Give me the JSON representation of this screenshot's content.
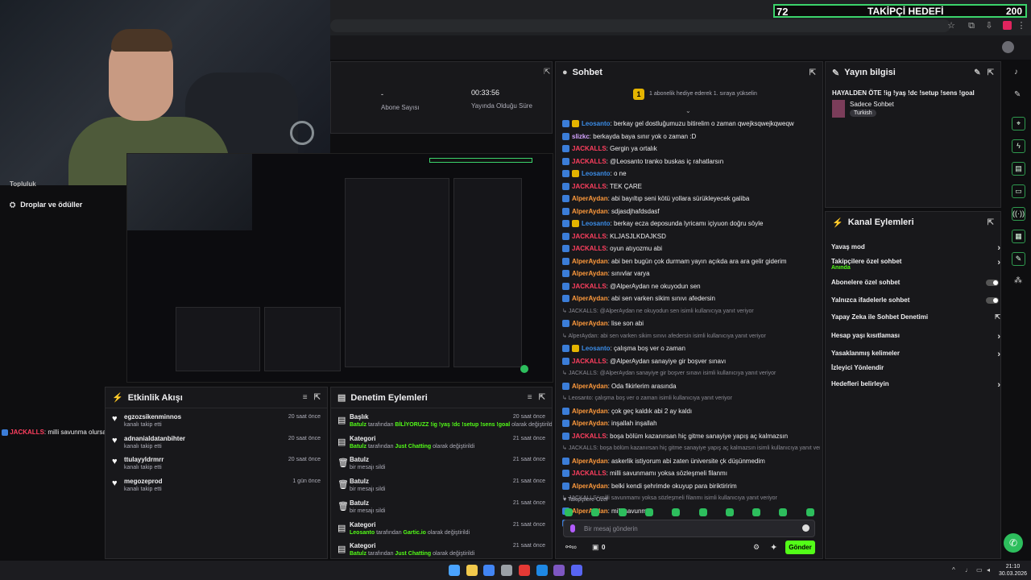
{
  "goal": {
    "current": "72",
    "title": "TAKİPÇİ HEDEFİ",
    "target": "200"
  },
  "stats": [
    {
      "value": "-",
      "label": "Abone Sayısı"
    },
    {
      "value": "00:33:56",
      "label": "Yayında Olduğu Süre"
    }
  ],
  "left_nav": {
    "item_rewards": "Droplar ve ödüller",
    "item_partial": "Topluluk"
  },
  "overlay_chat": {
    "user": "JACKALLS",
    "text": ": milli savunma olursa iyide diğerleri boş"
  },
  "chat": {
    "title": "Sohbet",
    "banner": "1 abonelik hediye ederek 1. sıraya yükselin",
    "messages": [
      {
        "user": "Leosanto",
        "color": "#3b8de8",
        "crown": true,
        "text": ": berkay gel dostluğumuzu bitirelim o zaman qwejksqwejkqweqw"
      },
      {
        "user": "slizkc",
        "color": "#d4a3ff",
        "text": ": berkayda baya sınır yok o zaman :D"
      },
      {
        "user": "JACKALLS",
        "color": "#ff3f5f",
        "text": ": Gergin ya ortalık"
      },
      {
        "user": "JACKALLS",
        "color": "#ff3f5f",
        "text": ": @Leosanto tranko buskas iç rahatlarsın"
      },
      {
        "user": "Leosanto",
        "color": "#3b8de8",
        "crown": true,
        "text": ": o ne"
      },
      {
        "user": "JACKALLS",
        "color": "#ff3f5f",
        "text": ": TEK ÇARE"
      },
      {
        "user": "AlperAydan",
        "color": "#ff9a3c",
        "text": ": abi bayıltıp seni kötü yollara sürükleyecek galiba"
      },
      {
        "user": "AlperAydan",
        "color": "#ff9a3c",
        "text": ": sdjasdjhafdsdasf"
      },
      {
        "user": "Leosanto",
        "color": "#3b8de8",
        "crown": true,
        "text": ": berkay ecza deposunda lyricamı içiyuon doğru söyle"
      },
      {
        "user": "JACKALLS",
        "color": "#ff3f5f",
        "text": ": KLJASJLKDAJKSD"
      },
      {
        "user": "JACKALLS",
        "color": "#ff3f5f",
        "text": ": oyun atıyozmu abi"
      },
      {
        "user": "AlperAydan",
        "color": "#ff9a3c",
        "text": ": abi ben bugün çok durmam yayın açıkda ara ara gelir giderim"
      },
      {
        "user": "AlperAydan",
        "color": "#ff9a3c",
        "text": ": sınıvlar varya"
      },
      {
        "user": "JACKALLS",
        "color": "#ff3f5f",
        "text": ": @AlperAydan ne okuyodun sen"
      },
      {
        "user": "AlperAydan",
        "color": "#ff9a3c",
        "text": ": abi sen varken sikim sınıvı afedersin"
      },
      {
        "reply": "JACKALLS: @AlperAydan ne okuyodun sen isimli kullanıcıya yanıt veriyor"
      },
      {
        "user": "AlperAydan",
        "color": "#ff9a3c",
        "text": ": lise son abi"
      },
      {
        "reply": "AlperAydan: abi sen varken sikim sınıvı afedersin isimli kullanıcıya yanıt veriyor"
      },
      {
        "user": "Leosanto",
        "color": "#3b8de8",
        "crown": true,
        "text": ": çalışma boş ver o zaman"
      },
      {
        "user": "JACKALLS",
        "color": "#ff3f5f",
        "text": ": @AlperAydan sanayiye gir boşver sınavı"
      },
      {
        "reply": "JACKALLS: @AlperAydan sanayiye gir boşver sınavı isimli kullanıcıya yanıt veriyor"
      },
      {
        "user": "AlperAydan",
        "color": "#ff9a3c",
        "text": ": Oda fikirlerim arasında"
      },
      {
        "reply": "Leosanto: çalışma boş ver o zaman isimli kullanıcıya yanıt veriyor"
      },
      {
        "user": "AlperAydan",
        "color": "#ff9a3c",
        "text": ": çok geç kaldık abi 2 ay kaldı"
      },
      {
        "user": "AlperAydan",
        "color": "#ff9a3c",
        "text": ": inşallah inşallah"
      },
      {
        "user": "JACKALLS",
        "color": "#ff3f5f",
        "text": ": boşa bölüm kazanırsan hiç gitme sanayiye yapış aç kalmazsın"
      },
      {
        "reply": "JACKALLS: boşa bölüm kazanırsan hiç gitme sanayiye yapış aç kalmazsın isimli kullanıcıya yanıt veriyor"
      },
      {
        "user": "AlperAydan",
        "color": "#ff9a3c",
        "text": ": askerlik istiyorum abi zaten üniversite çk düşünmedim"
      },
      {
        "user": "JACKALLS",
        "color": "#ff3f5f",
        "text": ": milli savunmamı yoksa sözleşmeli filanmı"
      },
      {
        "user": "AlperAydan",
        "color": "#ff9a3c",
        "text": ": belki kendi şehrimde okuyup para biriktiririm"
      },
      {
        "reply": "JACKALLS: milli savunmamı yoksa sözleşmeli filanmı isimli kullanıcıya yanıt veriyor"
      },
      {
        "user": "AlperAydan",
        "color": "#ff9a3c",
        "text": ": milli savunma"
      },
      {
        "user": "JACKALLS",
        "color": "#ff3f5f",
        "text": ": milli savunma olursa iyide diğerleri boş"
      }
    ],
    "mode_label": "Takipçilere Özel",
    "input_placeholder": "Bir mesaj gönderin",
    "points": "0",
    "send_label": "Gönder"
  },
  "stream_info": {
    "title_label": "Yayın bilgisi",
    "title": "HAYALDEN ÖTE !ig !yaş !dc !setup !sens !goal",
    "category": "Sadece Sohbet",
    "tag": "Turkish"
  },
  "channel_actions": {
    "title": "Kanal Eylemleri",
    "items": [
      {
        "label": "Yavaş mod",
        "type": "chevron"
      },
      {
        "label": "Takipçilere özel sohbet",
        "sub": "Anında",
        "type": "chevron"
      },
      {
        "label": "Abonelere özel sohbet",
        "type": "toggle"
      },
      {
        "label": "Yalnızca ifadelerle sohbet",
        "type": "toggle"
      },
      {
        "label": "Yapay Zeka ile Sohbet Denetimi",
        "type": "external"
      },
      {
        "label": "Hesap yaşı kısıtlaması",
        "type": "chevron"
      },
      {
        "label": "Yasaklanmış kelimeler",
        "type": "chevron"
      },
      {
        "label": "İzleyici Yönlendir",
        "type": "none"
      },
      {
        "label": "Hedefleri belirleyin",
        "type": "chevron"
      }
    ]
  },
  "activity": {
    "title": "Etkinlik Akışı",
    "items": [
      {
        "name": "egzozsikenminnos",
        "sub": "kanalı takip etti",
        "time": "20 saat önce"
      },
      {
        "name": "adnanialdatanbihter",
        "sub": "kanalı takip etti",
        "time": "20 saat önce"
      },
      {
        "name": "ttulayyldrmrr",
        "sub": "kanalı takip etti",
        "time": "20 saat önce"
      },
      {
        "name": "megozeprod",
        "sub": "kanalı takip etti",
        "time": "1 gün önce"
      }
    ]
  },
  "moderation": {
    "title": "Denetim Eylemleri",
    "items": [
      {
        "title": "Başlık",
        "actor": "Batulz",
        "rest": " tarafından ",
        "value": "BİLİYORUZZ !ig !yaş !dc !setup !sens !goal",
        "tail": " olarak değiştirildi",
        "time": "20 saat önce"
      },
      {
        "title": "Kategori",
        "actor": "Batulz",
        "rest": " tarafından ",
        "value": "Just Chatting",
        "tail": " olarak değiştirildi",
        "time": "21 saat önce"
      },
      {
        "title": "Batulz",
        "plain": "bir mesajı sildi",
        "time": "21 saat önce"
      },
      {
        "title": "Batulz",
        "plain": "bir mesajı sildi",
        "time": "21 saat önce"
      },
      {
        "title": "Batulz",
        "plain": "bir mesajı sildi",
        "time": "21 saat önce"
      },
      {
        "title": "Kategori",
        "actor": "Leosanto",
        "rest": " tarafından ",
        "value": "Gartic.io",
        "tail": " olarak değiştirildi",
        "time": "21 saat önce"
      },
      {
        "title": "Kategori",
        "actor": "Batulz",
        "rest": " tarafından ",
        "value": "Just Chatting",
        "tail": " olarak değiştirildi",
        "time": "21 saat önce"
      }
    ]
  },
  "clock": {
    "time": "21:10",
    "date": "30.03.2026"
  },
  "colors": {
    "accent": "#53fc18",
    "panel": "#18181b",
    "bg": "#0e0e10"
  }
}
